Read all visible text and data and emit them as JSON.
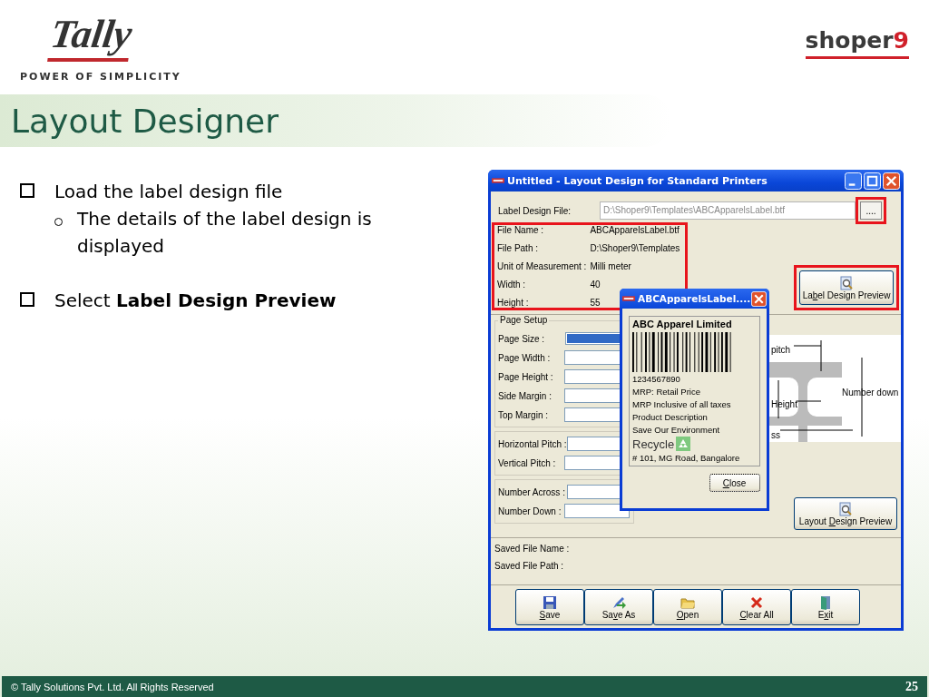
{
  "header": {
    "logo": "Tally",
    "tagline": "POWER OF SIMPLICITY",
    "product": {
      "name": "shoper",
      "number": "9"
    }
  },
  "title": "Layout Designer",
  "bullets": [
    {
      "text": "Load the label design file",
      "children": [
        {
          "text": "The details of the label design is displayed"
        }
      ]
    },
    {
      "text": "Select **Label Design Preview**"
    }
  ],
  "window": {
    "title": "Untitled - Layout Design for Standard Printers",
    "file": {
      "label": "Label Design File:",
      "value": "D:\\Shoper9\\Templates\\ABCApparelsLabel.btf",
      "disabled": true
    },
    "browse": {
      "text": "....",
      "highlighted": true
    },
    "info": {
      "highlighted": true,
      "rows": [
        {
          "label": "File Name :",
          "value": "ABCApparelsLabel.btf"
        },
        {
          "label": "File Path :",
          "value": "D:\\Shoper9\\Templates"
        },
        {
          "label": "Unit of Measurement :",
          "value": "Milli meter"
        },
        {
          "label": "Width :",
          "value": "40"
        },
        {
          "label": "Height :",
          "value": "55"
        }
      ]
    },
    "preview_button": {
      "label": {
        "pre": "La",
        "key": "b",
        "post": "el Design Preview"
      },
      "highlighted": true
    },
    "page_setup": {
      "legend": "Page Setup",
      "groups": [
        [
          {
            "label": "Page Size :",
            "kind": "dropdown",
            "focused": true
          },
          {
            "label": "Page Width :",
            "kind": "text",
            "focused": false
          },
          {
            "label": "Page Height :",
            "kind": "text",
            "focused": false
          },
          {
            "label": "Side Margin :",
            "kind": "text",
            "focused": false
          },
          {
            "label": "Top Margin :",
            "kind": "text",
            "focused": false
          }
        ],
        [
          {
            "label": "Horizontal Pitch :",
            "kind": "text",
            "focused": false
          },
          {
            "label": "Vertical Pitch :",
            "kind": "text",
            "focused": false
          }
        ],
        [
          {
            "label": "Number Across :",
            "kind": "text",
            "focused": false
          },
          {
            "label": "Number Down :",
            "kind": "text",
            "focused": false
          }
        ]
      ]
    },
    "diagram": {
      "pitch": "pitch",
      "height": "Height",
      "number_down": "Number down",
      "across": "ss"
    },
    "layout_preview_button": {
      "pre": "Layout ",
      "key": "D",
      "post": "esign Preview"
    },
    "saved": [
      {
        "label": "Saved File Name :"
      },
      {
        "label": "Saved File Path   :"
      }
    ],
    "toolbar": [
      {
        "kind": "save",
        "label": {
          "key": "S",
          "post": "ave"
        }
      },
      {
        "kind": "save_as",
        "label": {
          "pre": "Sa",
          "key": "v",
          "post": "e As"
        }
      },
      {
        "kind": "open",
        "label": {
          "key": "O",
          "post": "pen"
        }
      },
      {
        "kind": "clear",
        "label": {
          "key": "C",
          "post": "lear All"
        }
      },
      {
        "kind": "exit",
        "label": {
          "pre": "E",
          "key": "x",
          "post": "it"
        }
      }
    ],
    "popup": {
      "title": "ABCApparelsLabel....",
      "company": "ABC Apparel Limited",
      "barcode_number": "1234567890",
      "lines": [
        "MRP:  Retail Price",
        "MRP Inclusive of all taxes",
        "Product Description",
        "Save Our Environment"
      ],
      "recycle": "Recycle",
      "address": "# 101, MG Road, Bangalore",
      "close": {
        "key": "C",
        "post": "lose"
      }
    }
  },
  "footer": {
    "copyright": "© Tally Solutions Pvt. Ltd. All Rights Reserved",
    "page": "25"
  }
}
